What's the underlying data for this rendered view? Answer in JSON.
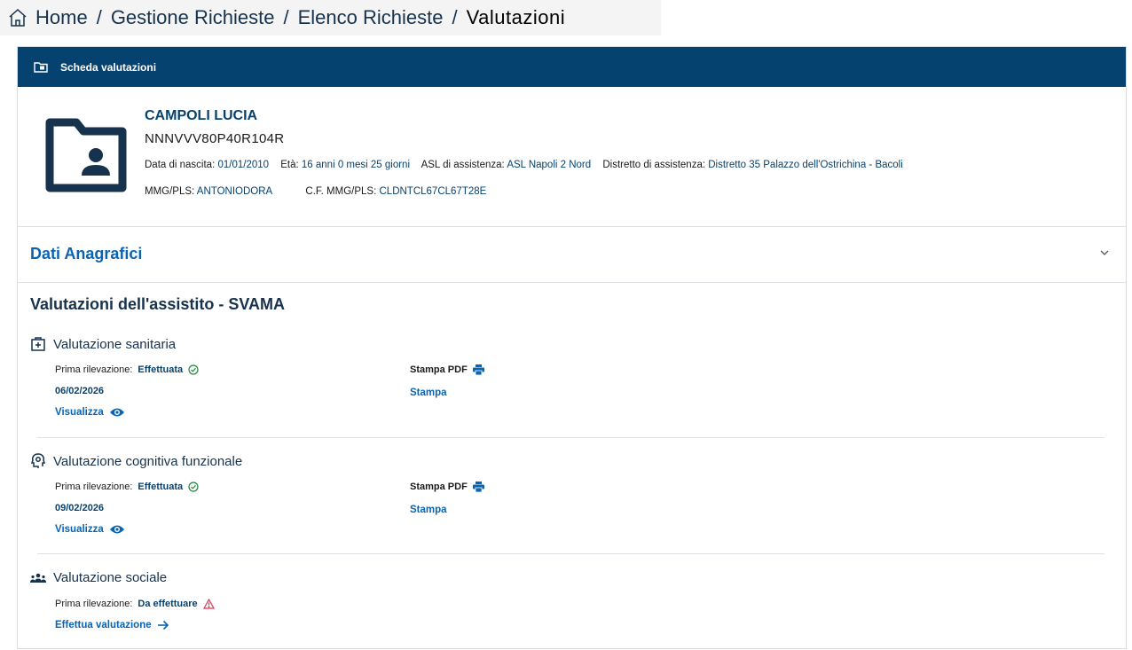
{
  "breadcrumb": {
    "items": [
      "Home",
      "Gestione Richieste",
      "Elenco Richieste"
    ],
    "separator": "/",
    "current": "Valutazioni"
  },
  "card": {
    "header_title": "Scheda valutazioni"
  },
  "patient": {
    "name": "CAMPOLI LUCIA",
    "fiscal_code": "NNNVVV80P40R104R",
    "birth_label": "Data di nascita:",
    "birth_value": "01/01/2010",
    "age_label": "Età:",
    "age_value": "16 anni 0 mesi 25 giorni",
    "asl_label": "ASL di assistenza:",
    "asl_value": "ASL Napoli 2 Nord",
    "district_label": "Distretto di assistenza:",
    "district_value": "Distretto 35 Palazzo dell'Ostrichina - Bacoli",
    "mmg_label": "MMG/PLS:",
    "mmg_value": "ANTONIODORA",
    "cf_mmg_label": "C.F. MMG/PLS:",
    "cf_mmg_value": "CLDNTCL67CL67T28E"
  },
  "anagrafici": {
    "title": "Dati Anagrafici"
  },
  "valutazioni": {
    "title": "Valutazioni dell'assistito - SVAMA",
    "sanitaria": {
      "title": "Valutazione sanitaria",
      "rilevazione_label": "Prima rilevazione:",
      "rilevazione_status": "Effettuata",
      "date": "06/02/2026",
      "view_link": "Visualizza",
      "pdf_label": "Stampa PDF",
      "print_link": "Stampa"
    },
    "cognitiva": {
      "title": "Valutazione cognitiva funzionale",
      "rilevazione_label": "Prima rilevazione:",
      "rilevazione_status": "Effettuata",
      "date": "09/02/2026",
      "view_link": "Visualizza",
      "pdf_label": "Stampa PDF",
      "print_link": "Stampa"
    },
    "sociale": {
      "title": "Valutazione sociale",
      "rilevazione_label": "Prima rilevazione:",
      "rilevazione_status": "Da effettuare",
      "action_link": "Effettua valutazione"
    }
  },
  "colors": {
    "header_bg": "#06426f",
    "link_blue": "#0a64b4",
    "success_green": "#1e8a3c",
    "warning_red": "#d9364f"
  }
}
